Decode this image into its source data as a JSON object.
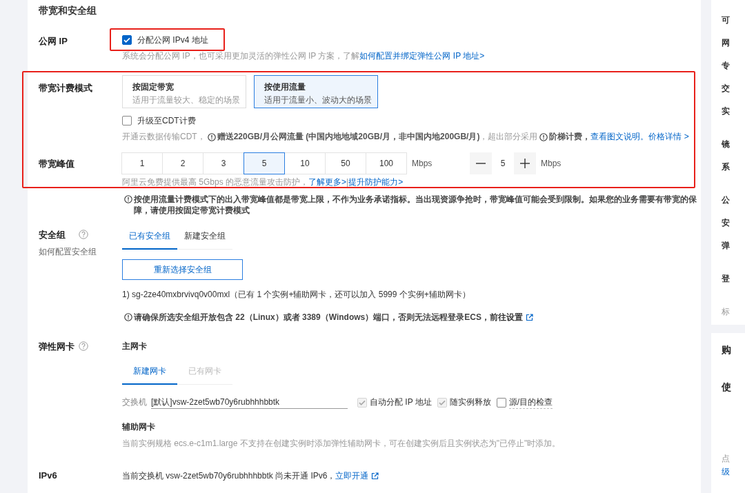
{
  "section_title": "带宽和安全组",
  "public_ip": {
    "label": "公网 IP",
    "highlighted": true,
    "checkbox": {
      "label": "分配公网 IPv4 地址",
      "checked": true
    },
    "description": "系统会分配公网 IP，也可采用更加灵活的弹性公网 IP 方案，了解",
    "link": "如何配置并绑定弹性公网 IP 地址>"
  },
  "billing": {
    "highlighted": true,
    "label": "带宽计费模式",
    "options": [
      {
        "title": "按固定带宽",
        "subtitle": "适用于流量较大、稳定的场景",
        "selected": false
      },
      {
        "title": "按使用流量",
        "subtitle": "适用于流量小、波动大的场景",
        "selected": true
      }
    ],
    "cdt_checkbox": {
      "label": "升级至CDT计费",
      "checked": false
    },
    "cdt_note": [
      {
        "kind": "text",
        "text": "开通云数据传输CDT，"
      },
      {
        "kind": "info",
        "text": "赠送220GB/月公网流量 (中国内地地域20GB/月，非中国内地200GB/月)"
      },
      {
        "kind": "text",
        "text": "，超出部分采用"
      },
      {
        "kind": "info",
        "text": "阶梯计费，"
      },
      {
        "kind": "link",
        "text": "查看图文说明。"
      },
      {
        "kind": "link",
        "text": "价格详情 >"
      }
    ],
    "peak_label": "带宽峰值",
    "peak_options": [
      {
        "value": "1",
        "selected": false
      },
      {
        "value": "2",
        "selected": false
      },
      {
        "value": "3",
        "selected": false
      },
      {
        "value": "5",
        "selected": true
      },
      {
        "value": "10",
        "selected": false
      },
      {
        "value": "50",
        "selected": false
      },
      {
        "value": "100",
        "selected": false
      }
    ],
    "peak_unit": "Mbps",
    "stepper_value": "5",
    "stepper_unit": "Mbps",
    "protection_note": [
      {
        "kind": "text",
        "text": "阿里云免费提供最高 5Gbps 的恶意流量攻击防护，"
      },
      {
        "kind": "link",
        "text": "了解更多>"
      },
      {
        "kind": "text",
        "text": "|"
      },
      {
        "kind": "link",
        "text": "提升防护能力>"
      }
    ]
  },
  "peak_warning": "按使用流量计费模式下的出入带宽峰值都是带宽上限，不作为业务承诺指标。当出现资源争抢时，带宽峰值可能会受到限制。如果您的业务需要有带宽的保障，请使用按固定带宽计费模式",
  "security_group": {
    "label": "安全组",
    "sublabel": "如何配置安全组",
    "tabs": [
      {
        "label": "已有安全组",
        "selected": true
      },
      {
        "label": "新建安全组",
        "selected": false
      }
    ],
    "button": "重新选择安全组",
    "selected_group": "1) sg-2ze40mxbrvivq0v00mxl（已有 1 个实例+辅助网卡，还可以加入 5999 个实例+辅助网卡）",
    "warning": "请确保所选安全组开放包含 22（Linux）或者 3389（Windows）端口，否则无法远程登录ECS，",
    "warning_link": "前往设置"
  },
  "eni": {
    "label": "弹性网卡",
    "primary_title": "主网卡",
    "tabs": [
      {
        "label": "新建网卡",
        "selected": true,
        "disabled": false
      },
      {
        "label": "已有网卡",
        "selected": false,
        "disabled": true
      }
    ],
    "switch_label": "交换机",
    "switch_value": "[默认]vsw-2zet5wb70y6rubhhhbbtk",
    "options": [
      {
        "label": "自动分配 IP 地址",
        "checked": true,
        "disabled": true
      },
      {
        "label": "随实例释放",
        "checked": true,
        "disabled": true
      },
      {
        "label": "源/目的检查",
        "checked": false,
        "disabled": false
      }
    ],
    "secondary_title": "辅助网卡",
    "secondary_note": "当前实例规格 ecs.e-c1m1.large 不支持在创建实例时添加弹性辅助网卡，可在创建实例后且实例状态为\"已停止\"时添加。"
  },
  "ipv6": {
    "label": "IPv6",
    "text": "当前交换机 vsw-2zet5wb70y6rubhhhbbtk 尚未开通 IPv6，",
    "link": "立即开通"
  },
  "summary_panel": {
    "groups": [
      {
        "items": [
          "可",
          "网",
          "专",
          "交",
          "实"
        ]
      },
      {
        "items": [
          "镜",
          "系"
        ]
      },
      {
        "items": [
          "公",
          "安",
          "弹"
        ]
      },
      {
        "items": [
          "登"
        ]
      }
    ],
    "tag": "标",
    "headings": [
      "购",
      "使"
    ],
    "note": "点",
    "note_link": "级"
  }
}
